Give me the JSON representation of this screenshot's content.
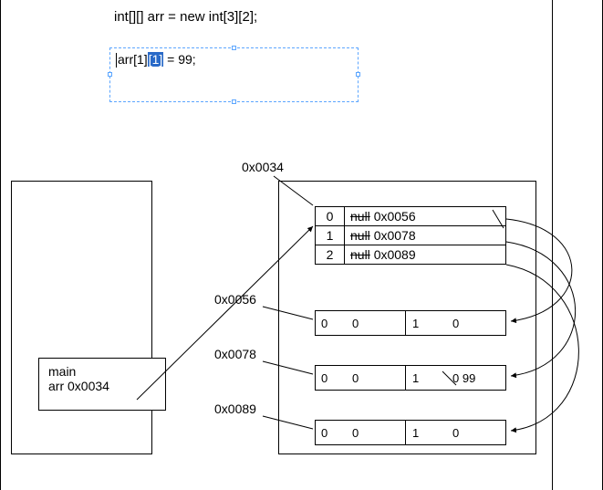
{
  "code": {
    "declaration": "int[][] arr = new int[3][2];",
    "assignment_prefix": "arr[1]",
    "assignment_selected": "[1]",
    "assignment_suffix": " = 99;"
  },
  "stack": {
    "frame_label": "main",
    "var_name": "arr",
    "var_value": "0x0034"
  },
  "heap": {
    "outer_addr": "0x0034",
    "rows": [
      {
        "index": "0",
        "old": "null",
        "val": "0x0056"
      },
      {
        "index": "1",
        "old": "null",
        "val": "0x0078"
      },
      {
        "index": "2",
        "old": "null",
        "val": "0x0089"
      }
    ],
    "sub": [
      {
        "addr": "0x0056",
        "i0": "0",
        "v0": "0",
        "i1": "1",
        "v1": "0",
        "extra": ""
      },
      {
        "addr": "0x0078",
        "i0": "0",
        "v0": "0",
        "i1": "1",
        "v1": "0 99",
        "extra": ""
      },
      {
        "addr": "0x0089",
        "i0": "0",
        "v0": "0",
        "i1": "1",
        "v1": "0",
        "extra": ""
      }
    ]
  }
}
